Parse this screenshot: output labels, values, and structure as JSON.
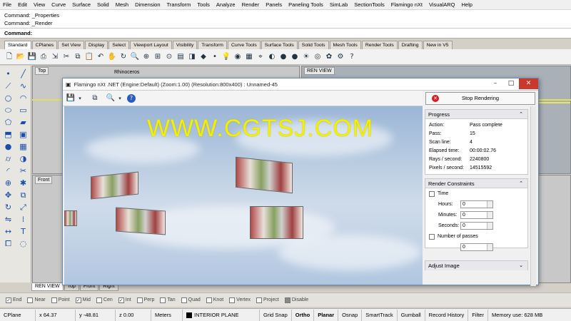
{
  "menu": [
    "File",
    "Edit",
    "View",
    "Curve",
    "Surface",
    "Solid",
    "Mesh",
    "Dimension",
    "Transform",
    "Tools",
    "Analyze",
    "Render",
    "Panels",
    "Paneling Tools",
    "SimLab",
    "SectionTools",
    "Flamingo nXt",
    "VisualARQ",
    "Help"
  ],
  "command_history": [
    "Command: _Properties",
    "Command: _Render"
  ],
  "command_prompt": "Command:",
  "toolbar_tabs": [
    "Standard",
    "CPlanes",
    "Set View",
    "Display",
    "Select",
    "Viewport Layout",
    "Visibility",
    "Transform",
    "Curve Tools",
    "Surface Tools",
    "Solid Tools",
    "Mesh Tools",
    "Render Tools",
    "Drafting",
    "New in V5"
  ],
  "toolbar_icons": [
    "new-icon",
    "open-icon",
    "save-icon",
    "print-icon",
    "import-icon",
    "cut-icon",
    "copy-icon",
    "paste-icon",
    "undo-icon",
    "pan-icon",
    "rotate-icon",
    "zoom-icon",
    "zoom-window-icon",
    "zoom-extents-icon",
    "zoom-selected-icon",
    "layer-icon",
    "properties-icon",
    "object-icon",
    "point-icon",
    "lights-icon",
    "render-icon",
    "grid-icon",
    "osnap-icon",
    "material-icon",
    "sphere-icon",
    "sphere-icon",
    "environment-icon",
    "camera-icon",
    "flamingo-icon",
    "settings-icon",
    "help-icon"
  ],
  "left_tools": [
    "point-icon",
    "line-icon",
    "polyline-icon",
    "curve-icon",
    "circle-icon",
    "arc-icon",
    "ellipse-icon",
    "rectangle-icon",
    "polygon-icon",
    "surface-icon",
    "extrude-icon",
    "box-icon",
    "sphere-icon",
    "mesh-icon",
    "cylinder-icon",
    "boolean-icon",
    "fillet-icon",
    "trim-icon",
    "join-icon",
    "explode-icon",
    "move-icon",
    "copy-icon",
    "rotate-icon",
    "scale-icon",
    "mirror-icon",
    "array-icon",
    "dimension-icon",
    "text-icon",
    "group-icon",
    "hide-icon"
  ],
  "viewports": {
    "top": "Top",
    "front": "Front",
    "perspective_title": "Rhinoceros",
    "ren_view": "REN VIEW"
  },
  "viewport_tabs": [
    "REN VIEW",
    "Top",
    "Front",
    "Right"
  ],
  "flamingo": {
    "title": "Flamingo nXt .NET (Engine:Default) (Zoom:1.00) (Resolution:800x400) : Unnamed-45",
    "stop_button": "Stop Rendering",
    "progress": {
      "header": "Progress",
      "rows": [
        {
          "k": "Action:",
          "v": "Pass complete"
        },
        {
          "k": "Pass:",
          "v": "15"
        },
        {
          "k": "Scan line:",
          "v": "4"
        },
        {
          "k": "Elapsed time:",
          "v": "00:00:02.76"
        },
        {
          "k": "Rays / second:",
          "v": "2240800"
        },
        {
          "k": "Pixels / second:",
          "v": "14515592"
        }
      ]
    },
    "constraints": {
      "header": "Render Constraints",
      "time_label": "Time",
      "hours_label": "Hours:",
      "hours": "0",
      "minutes_label": "Minutes:",
      "minutes": "0",
      "seconds_label": "Seconds:",
      "seconds": "0",
      "passes_label": "Number of passes",
      "passes": "0"
    },
    "adjust_image": "Adjust Image",
    "watermark": "WWW.CGTSJ.COM"
  },
  "osnaps": [
    {
      "label": "End",
      "checked": true
    },
    {
      "label": "Near",
      "checked": false
    },
    {
      "label": "Point",
      "checked": false
    },
    {
      "label": "Mid",
      "checked": true
    },
    {
      "label": "Cen",
      "checked": false
    },
    {
      "label": "Int",
      "checked": true
    },
    {
      "label": "Perp",
      "checked": false
    },
    {
      "label": "Tan",
      "checked": false
    },
    {
      "label": "Quad",
      "checked": false
    },
    {
      "label": "Knot",
      "checked": false
    },
    {
      "label": "Vertex",
      "checked": false
    },
    {
      "label": "Project",
      "checked": false
    },
    {
      "label": "Disable",
      "checked": false
    }
  ],
  "status": {
    "cplane": "CPlane",
    "x": "x 64.37",
    "y": "y -48.81",
    "z": "z 0.00",
    "units": "Meters",
    "layer": "INTERIOR PLANE",
    "toggles": [
      "Grid Snap",
      "Ortho",
      "Planar",
      "Osnap",
      "SmartTrack",
      "Gumball",
      "Record History",
      "Filter"
    ],
    "memory": "Memory use: 628 MB"
  }
}
